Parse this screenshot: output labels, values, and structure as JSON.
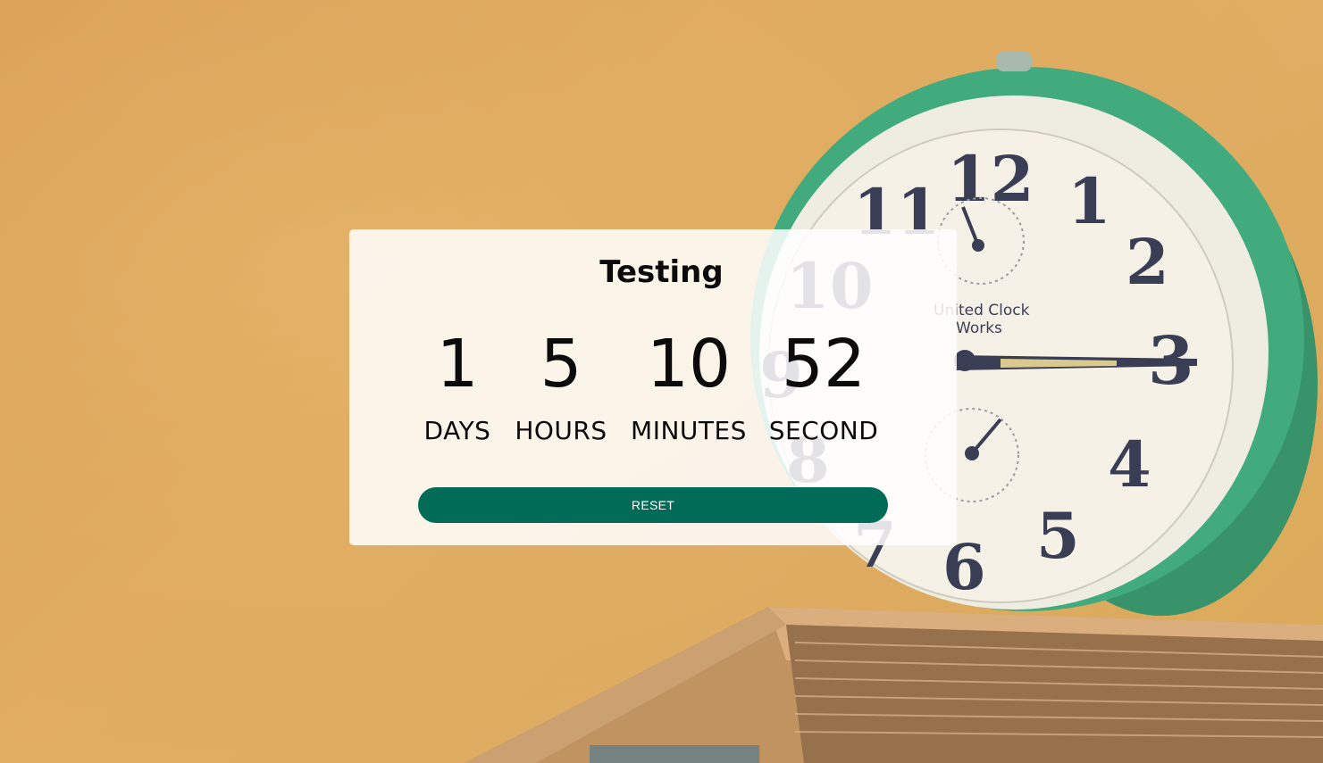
{
  "countdown": {
    "title": "Testing",
    "units": [
      {
        "value": "1",
        "label": "DAYS"
      },
      {
        "value": "5",
        "label": "HOURS"
      },
      {
        "value": "10",
        "label": "MINUTES"
      },
      {
        "value": "52",
        "label": "SECOND"
      }
    ],
    "reset_label": "RESET"
  },
  "background": {
    "description_icon": "alarm-clock-on-book",
    "clock_brand_line1": "United Clock",
    "clock_brand_line2": "Works",
    "clock_numerals": [
      "12",
      "1",
      "2",
      "3",
      "4",
      "5",
      "6",
      "7",
      "8",
      "9",
      "10",
      "11"
    ]
  },
  "colors": {
    "background": "#dca85a",
    "card": "#fdf6ec",
    "button": "#016b58",
    "button_text": "#ffffff",
    "clock_rim": "#2aa678",
    "text": "#0b0b0b"
  }
}
